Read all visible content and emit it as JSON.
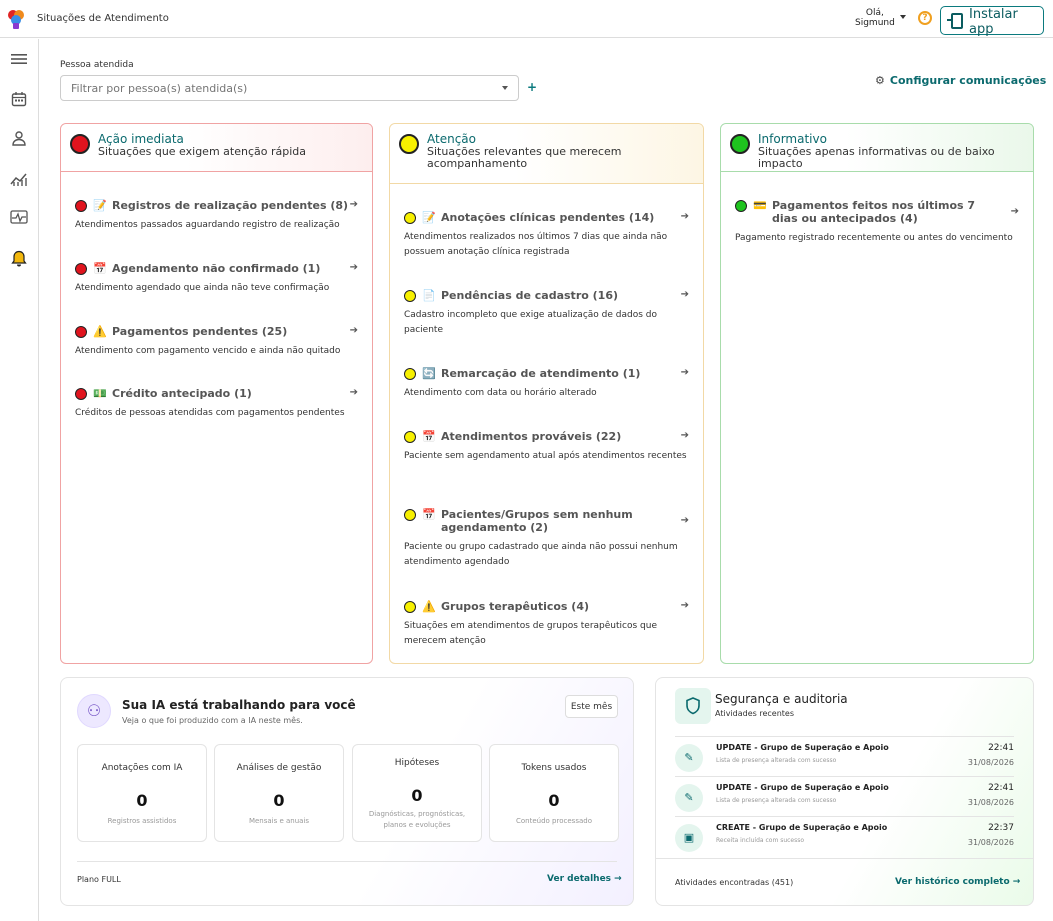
{
  "topbar": {
    "app_title": "Situações de Atendimento",
    "greeting": "Olá,",
    "user": "Sigmund",
    "help_icon": "question-circle-icon",
    "install_label": "Instalar app"
  },
  "sidebar": {
    "items": [
      {
        "name": "menu",
        "icon": "hamburger-icon"
      },
      {
        "name": "calendar",
        "icon": "calendar-icon"
      },
      {
        "name": "person",
        "icon": "person-icon"
      },
      {
        "name": "chart",
        "icon": "chart-icon"
      },
      {
        "name": "pulse",
        "icon": "pulse-icon"
      },
      {
        "name": "notifications",
        "icon": "bell-icon",
        "active": true
      }
    ]
  },
  "filter": {
    "label": "Pessoa atendida",
    "placeholder": "Filtrar por pessoa(s) atendida(s)",
    "add": "+",
    "config_label": "Configurar comunicações"
  },
  "colors": {
    "red": "#e0141e",
    "yellow": "#f7f000",
    "green": "#1fc41f",
    "teal": "#0b6a6e"
  },
  "sections": {
    "immediate": {
      "title": "Ação imediata",
      "subtitle": "Situações que exigem atenção rápida",
      "items": [
        {
          "icon": "📝",
          "title": "Registros de realização pendentes (8)",
          "desc": "Atendimentos passados aguardando registro de realização"
        },
        {
          "icon": "📅",
          "title": "Agendamento não confirmado (1)",
          "desc": "Atendimento agendado que ainda não teve confirmação"
        },
        {
          "icon": "⚠️",
          "title": "Pagamentos pendentes (25)",
          "desc": "Atendimento com pagamento vencido e ainda não quitado"
        },
        {
          "icon": "💵",
          "title": "Crédito antecipado (1)",
          "desc": "Créditos de pessoas atendidas com pagamentos pendentes"
        }
      ]
    },
    "attention": {
      "title": "Atenção",
      "subtitle": "Situações relevantes que merecem acompanhamento",
      "items": [
        {
          "icon": "📝",
          "title": "Anotações clínicas pendentes (14)",
          "desc": "Atendimentos realizados nos últimos 7 dias que ainda não possuem anotação clínica registrada"
        },
        {
          "icon": "📄",
          "title": "Pendências de cadastro (16)",
          "desc": "Cadastro incompleto que exige atualização de dados do paciente"
        },
        {
          "icon": "🔄",
          "title": "Remarcação de atendimento (1)",
          "desc": "Atendimento com data ou horário alterado"
        },
        {
          "icon": "📅",
          "title": "Atendimentos prováveis (22)",
          "desc": "Paciente sem agendamento atual após atendimentos recentes"
        },
        {
          "icon": "📅",
          "title": "Pacientes/Grupos sem nenhum agendamento (2)",
          "desc": "Paciente ou grupo cadastrado que ainda não possui nenhum atendimento agendado"
        },
        {
          "icon": "⚠️",
          "title": "Grupos terapêuticos (4)",
          "desc": "Situações em atendimentos de grupos terapêuticos que merecem atenção"
        }
      ]
    },
    "info": {
      "title": "Informativo",
      "subtitle": "Situações apenas informativas ou de baixo impacto",
      "items": [
        {
          "icon": "💳",
          "title": "Pagamentos feitos nos últimos 7 dias ou antecipados (4)",
          "desc": "Pagamento registrado recentemente ou antes do vencimento"
        }
      ]
    }
  },
  "ai": {
    "title": "Sua IA está trabalhando para você",
    "subtitle": "Veja o que foi produzido com a IA neste mês.",
    "period": "Este mês",
    "stats": [
      {
        "label": "Anotações com IA",
        "value": "0",
        "note": "Registros assistidos"
      },
      {
        "label": "Análises de gestão",
        "value": "0",
        "note": "Mensais e anuais"
      },
      {
        "label": "Hipóteses",
        "value": "0",
        "note": "Diagnósticas, prognósticas, planos e evoluções"
      },
      {
        "label": "Tokens usados",
        "value": "0",
        "note": "Conteúdo processado"
      }
    ],
    "plan_prefix": "Plano",
    "plan": "FULL",
    "link": "Ver detalhes →"
  },
  "security": {
    "title": "Segurança e auditoria",
    "subtitle": "Atividades recentes",
    "rows": [
      {
        "icon": "pencil-icon",
        "title": "UPDATE - Grupo de Superação e Apoio",
        "desc": "Lista de presença alterada com sucesso",
        "time": "22:41",
        "date": "31/08/2026"
      },
      {
        "icon": "pencil-icon",
        "title": "UPDATE - Grupo de Superação e Apoio",
        "desc": "Lista de presença alterada com sucesso",
        "time": "22:41",
        "date": "31/08/2026"
      },
      {
        "icon": "money-icon",
        "title": "CREATE - Grupo de Superação e Apoio",
        "desc": "Receita incluída com sucesso",
        "time": "22:37",
        "date": "31/08/2026"
      }
    ],
    "count": "Atividades encontradas (451)",
    "link": "Ver histórico completo →"
  }
}
